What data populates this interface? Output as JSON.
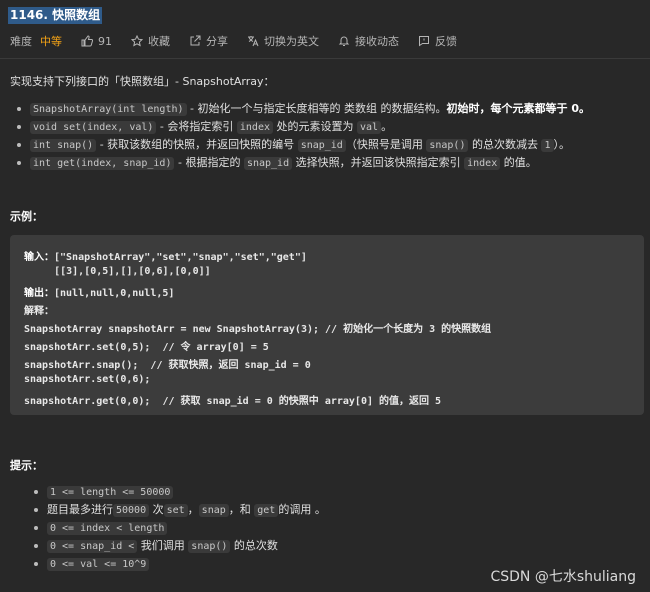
{
  "title": "1146. 快照数组",
  "meta": {
    "difficulty_label": "难度",
    "difficulty": "中等",
    "likes": "91",
    "favorite": "收藏",
    "share": "分享",
    "switch_lang": "切换为英文",
    "subscribe": "接收动态",
    "feedback": "反馈"
  },
  "intro": "实现支持下列接口的「快照数组」- SnapshotArray：",
  "methods": [
    {
      "code": "SnapshotArray(int length)",
      "desc": " - 初始化一个与指定长度相等的 类数组 的数据结构。",
      "strong": "初始时，每个元素都等于 0。"
    },
    {
      "code": "void set(index, val)",
      "desc1": " - 会将指定索引 ",
      "code2": "index",
      "desc2": " 处的元素设置为 ",
      "code3": "val",
      "desc3": "。"
    },
    {
      "code": "int snap()",
      "desc1": " - 获取该数组的快照，并返回快照的编号 ",
      "code2": "snap_id",
      "desc2": "（快照号是调用 ",
      "code3": "snap()",
      "desc3": " 的总次数减去 ",
      "code4": "1",
      "desc4": "）。"
    },
    {
      "code": "int get(index, snap_id)",
      "desc1": " - 根据指定的 ",
      "code2": "snap_id",
      "desc2": " 选择快照，并返回该快照指定索引 ",
      "code3": "index",
      "desc3": " 的值。"
    }
  ],
  "example_heading": "示例：",
  "example": {
    "input_label": "输入：",
    "input_1": "[\"SnapshotArray\",\"set\",\"snap\",\"set\",\"get\"]",
    "input_2": "     [[3],[0,5],[],[0,6],[0,0]]",
    "output_label": "输出：",
    "output": "[null,null,0,null,5]",
    "explain_label": "解释：",
    "lines": [
      "SnapshotArray snapshotArr = new SnapshotArray(3); // 初始化一个长度为 3 的快照数组",
      "snapshotArr.set(0,5);  // 令 array[0] = 5",
      "snapshotArr.snap();  // 获取快照，返回 snap_id = 0",
      "snapshotArr.set(0,6);",
      "snapshotArr.get(0,0);  // 获取 snap_id = 0 的快照中 array[0] 的值，返回 5"
    ]
  },
  "hints_heading": "提示：",
  "hints": {
    "h1": "1 <= length  <= 50000",
    "h2_pre": "题目最多进行",
    "h2_code1": "50000",
    "h2_mid1": " 次",
    "h2_code2": "set",
    "h2_mid2": "，",
    "h2_code3": "snap",
    "h2_mid3": "，和 ",
    "h2_code4": "get",
    "h2_post": "的调用 。",
    "h3": "0 <= index  <  length",
    "h4_code1": "0 <=  snap_id <",
    "h4_mid": "  我们调用 ",
    "h4_code2": "snap()",
    "h4_post": " 的总次数",
    "h5": "0 <=  val <= 10^9"
  },
  "watermark": "CSDN @七水shuliang"
}
